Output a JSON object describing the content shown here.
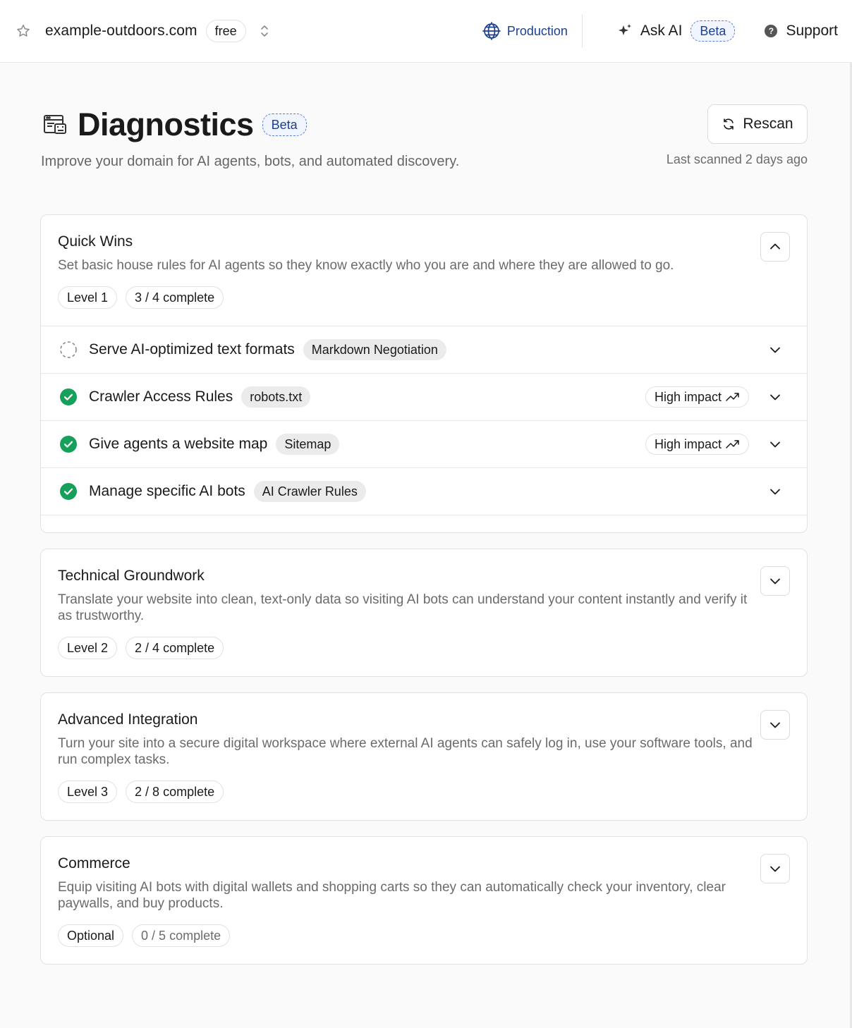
{
  "topbar": {
    "domain": "example-outdoors.com",
    "plan": "free",
    "environment": "Production",
    "ask_ai": "Ask AI",
    "ask_ai_badge": "Beta",
    "support": "Support"
  },
  "header": {
    "title": "Diagnostics",
    "badge": "Beta",
    "subtitle": "Improve your domain for AI agents, bots, and automated discovery.",
    "rescan_label": "Rescan",
    "last_scanned": "Last scanned 2 days ago"
  },
  "sections": [
    {
      "title": "Quick Wins",
      "description": "Set basic house rules for AI agents so they know exactly who you are and where they are allowed to go.",
      "level": "Level 1",
      "progress": "3 / 4 complete",
      "expanded": true,
      "items": [
        {
          "label": "Serve AI-optimized text formats",
          "chip": "Markdown Negotiation",
          "status": "pending",
          "impact": ""
        },
        {
          "label": "Crawler Access Rules",
          "chip": "robots.txt",
          "status": "complete",
          "impact": "High impact"
        },
        {
          "label": "Give agents a website map",
          "chip": "Sitemap",
          "status": "complete",
          "impact": "High impact"
        },
        {
          "label": "Manage specific AI bots",
          "chip": "AI Crawler Rules",
          "status": "complete",
          "impact": ""
        }
      ]
    },
    {
      "title": "Technical Groundwork",
      "description": "Translate your website into clean, text-only data so visiting AI bots can understand your content instantly and verify it as trustworthy.",
      "level": "Level 2",
      "progress": "2 / 4 complete",
      "expanded": false
    },
    {
      "title": "Advanced Integration",
      "description": "Turn your site into a secure digital workspace where external AI agents can safely log in, use your software tools, and run complex tasks.",
      "level": "Level 3",
      "progress": "2 / 8 complete",
      "expanded": false
    },
    {
      "title": "Commerce",
      "description": "Equip visiting AI bots with digital wallets and shopping carts so they can automatically check your inventory, clear paywalls, and buy products.",
      "level": "Optional",
      "progress": "0 / 5 complete",
      "expanded": false
    }
  ],
  "colors": {
    "accent": "#1d3f8f",
    "success": "#16a05a",
    "badge_border": "#5b7fd6"
  }
}
